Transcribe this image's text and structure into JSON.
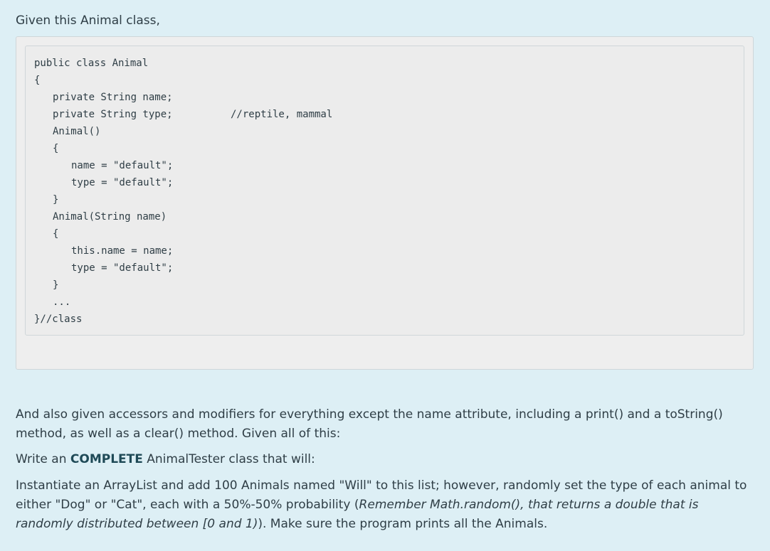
{
  "intro": "Given this Animal class,",
  "code_lines": [
    "public class Animal",
    "{",
    "private String name;",
    "private String type;",
    "//reptile, mammal",
    "Animal()",
    "{",
    "name = \"default\";",
    "type = \"default\";",
    "}",
    "Animal(String name)",
    "{",
    "this.name = name;",
    "type = \"default\";",
    "}",
    "...",
    "}//class"
  ],
  "para1": "And also given accessors and modifiers for everything except the name attribute, including a print() and a toString() method, as well as a clear() method.  Given all of this:",
  "para2": {
    "before": "Write an ",
    "bold": "COMPLETE",
    "after": " AnimalTester class that will:"
  },
  "para3": {
    "text": "Instantiate an ArrayList and add 100 Animals named \"Will\" to this list; however, randomly set the type of each animal to either \"Dog\" or \"Cat\", each with a 50%-50% probability (",
    "italic": "Remember Math.random(), that returns a double that is randomly distributed between [0 and 1)",
    "end": ").  Make sure the program prints all the Animals."
  }
}
